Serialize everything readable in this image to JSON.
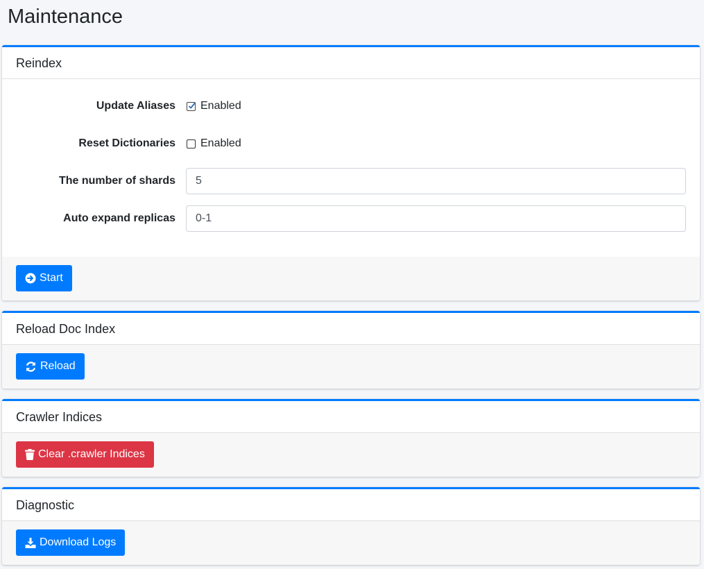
{
  "page": {
    "title": "Maintenance"
  },
  "reindex": {
    "header": "Reindex",
    "update_aliases": {
      "label": "Update Aliases",
      "checkbox_label": "Enabled",
      "checked": true
    },
    "reset_dictionaries": {
      "label": "Reset Dictionaries",
      "checkbox_label": "Enabled",
      "checked": false
    },
    "number_of_shards": {
      "label": "The number of shards",
      "value": "5"
    },
    "auto_expand_replicas": {
      "label": "Auto expand replicas",
      "value": "0-1"
    },
    "start_button": {
      "label": "Start",
      "icon": "arrow-circle-right-icon"
    }
  },
  "reload_doc_index": {
    "header": "Reload Doc Index",
    "reload_button": {
      "label": "Reload",
      "icon": "sync-icon"
    }
  },
  "crawler_indices": {
    "header": "Crawler Indices",
    "clear_button": {
      "label": "Clear .crawler Indices",
      "icon": "trash-icon"
    }
  },
  "diagnostic": {
    "header": "Diagnostic",
    "download_button": {
      "label": "Download Logs",
      "icon": "download-icon"
    }
  },
  "colors": {
    "primary": "#007bff",
    "danger": "#dc3545",
    "background": "#f4f6f9",
    "footer": "#f7f7f7"
  }
}
